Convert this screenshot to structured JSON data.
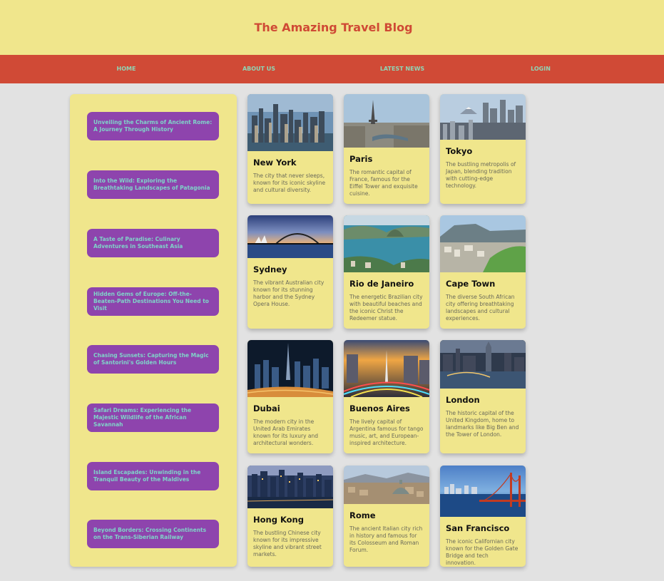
{
  "header": {
    "title": "The Amazing Travel Blog"
  },
  "nav": [
    {
      "label": "HOME"
    },
    {
      "label": "ABOUT US"
    },
    {
      "label": "LATEST NEWS"
    },
    {
      "label": "LOGIN"
    }
  ],
  "sidebar": {
    "links": [
      {
        "label": "Unveiling the Charms of Ancient Rome: A Journey Through History"
      },
      {
        "label": "Into the Wild: Exploring the Breathtaking Landscapes of Patagonia"
      },
      {
        "label": "A Taste of Paradise: Culinary Adventures in Southeast Asia"
      },
      {
        "label": "Hidden Gems of Europe: Off-the-Beaten-Path Destinations You Need to Visit"
      },
      {
        "label": "Chasing Sunsets: Capturing the Magic of Santorini's Golden Hours"
      },
      {
        "label": "Safari Dreams: Experiencing the Majestic Wildlife of the African Savannah"
      },
      {
        "label": "Island Escapades: Unwinding in the Tranquil Beauty of the Maldives"
      },
      {
        "label": "Beyond Borders: Crossing Continents on the Trans-Siberian Railway"
      }
    ]
  },
  "cities": [
    {
      "name": "New York",
      "description": "The city that never sleeps, known for its iconic skyline and cultural diversity."
    },
    {
      "name": "Paris",
      "description": "The romantic capital of France, famous for the Eiffel Tower and exquisite cuisine."
    },
    {
      "name": "Tokyo",
      "description": "The bustling metropolis of Japan, blending tradition with cutting-edge technology."
    },
    {
      "name": "Sydney",
      "description": "The vibrant Australian city known for its stunning harbor and the Sydney Opera House."
    },
    {
      "name": "Rio de Janeiro",
      "description": "The energetic Brazilian city with beautiful beaches and the iconic Christ the Redeemer statue."
    },
    {
      "name": "Cape Town",
      "description": "The diverse South African city offering breathtaking landscapes and cultural experiences."
    },
    {
      "name": "Dubai",
      "description": "The modern city in the United Arab Emirates known for its luxury and architectural wonders."
    },
    {
      "name": "Buenos Aires",
      "description": "The lively capital of Argentina famous for tango music, art, and European-inspired architecture."
    },
    {
      "name": "London",
      "description": "The historic capital of the United Kingdom, home to landmarks like Big Ben and the Tower of London."
    },
    {
      "name": "Hong Kong",
      "description": "The bustling Chinese city known for its impressive skyline and vibrant street markets."
    },
    {
      "name": "Rome",
      "description": "The ancient Italian city rich in history and famous for its Colosseum and Roman Forum."
    },
    {
      "name": "San Francisco",
      "description": "The iconic Californian city known for the Golden Gate Bridge and tech innovation."
    }
  ]
}
